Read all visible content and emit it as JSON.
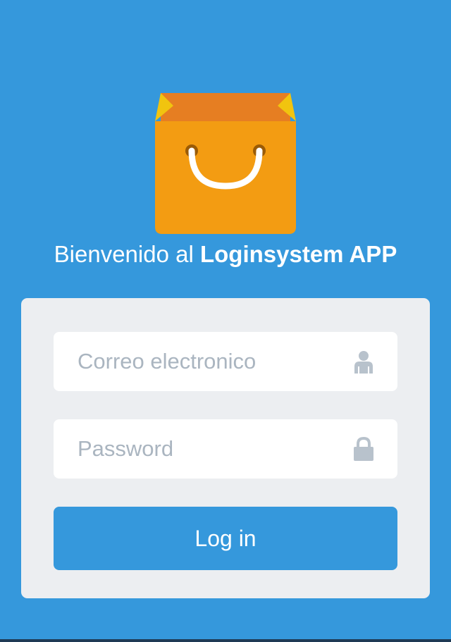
{
  "logo": {
    "icon": "shopping-bag-icon",
    "colors": {
      "bag": "#f39c12",
      "bag_top": "#e67e22",
      "bag_fold": "#f1c40f",
      "handle": "#ffffff"
    }
  },
  "welcome": {
    "prefix": "Bienvenido al ",
    "brand": "Loginsystem APP"
  },
  "form": {
    "email": {
      "placeholder": "Correo electronico",
      "value": "",
      "icon": "user-icon"
    },
    "password": {
      "placeholder": "Password",
      "value": "",
      "icon": "lock-icon"
    },
    "submit_label": "Log in"
  },
  "colors": {
    "background": "#3598dc",
    "card": "#eceef1",
    "button": "#3598dc",
    "placeholder": "#aab5c0",
    "icon": "#b8c2cc"
  }
}
